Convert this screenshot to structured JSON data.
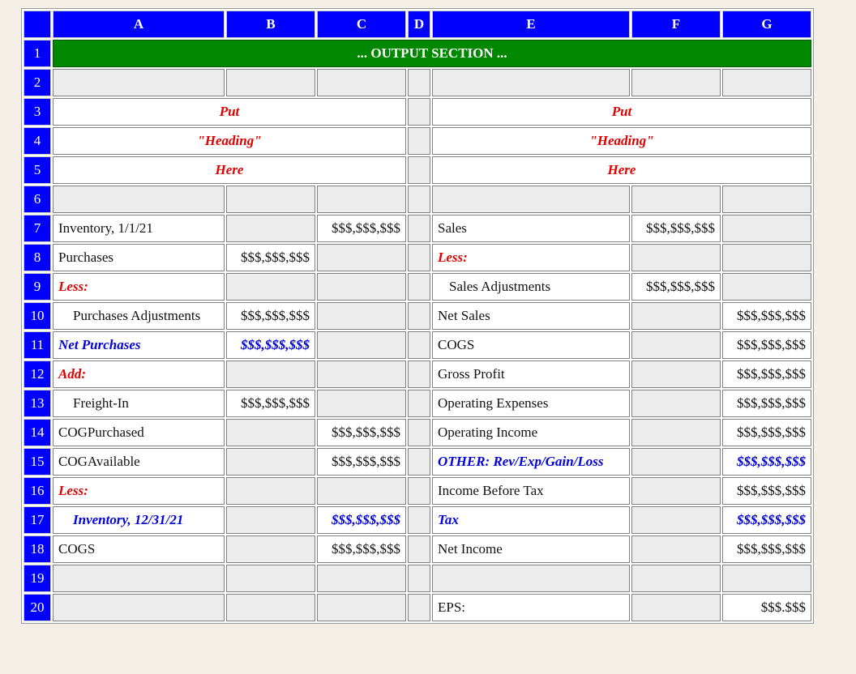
{
  "columns": [
    "A",
    "B",
    "C",
    "D",
    "E",
    "F",
    "G"
  ],
  "rows": [
    "1",
    "2",
    "3",
    "4",
    "5",
    "6",
    "7",
    "8",
    "9",
    "10",
    "11",
    "12",
    "13",
    "14",
    "15",
    "16",
    "17",
    "18",
    "19",
    "20"
  ],
  "title": "... OUTPUT SECTION ...",
  "heading": [
    "Put",
    "\"Heading\"",
    "Here"
  ],
  "left": {
    "inventory_begin": "Inventory, 1/1/21",
    "inventory_begin_amount": "$$$,$$$,$$$",
    "purchases": "Purchases",
    "purchases_amount": "$$$,$$$,$$$",
    "less": "Less:",
    "purchases_adjustments": "Purchases Adjustments",
    "purchases_adjustments_amount": "$$$,$$$,$$$",
    "net_purchases": "Net Purchases",
    "net_purchases_amount": "$$$,$$$,$$$",
    "add": "Add:",
    "freight_in": "Freight-In",
    "freight_in_amount": "$$$,$$$,$$$",
    "cog_purchased": "COGPurchased",
    "cog_purchased_amount": "$$$,$$$,$$$",
    "cog_available": "COGAvailable",
    "cog_available_amount": "$$$,$$$,$$$",
    "less2": "Less:",
    "inventory_end": "Inventory, 12/31/21",
    "inventory_end_amount": "$$$,$$$,$$$",
    "cogs": "COGS",
    "cogs_amount": "$$$,$$$,$$$"
  },
  "right": {
    "sales": "Sales",
    "sales_amount": "$$$,$$$,$$$",
    "less": "Less:",
    "sales_adjustments": "Sales Adjustments",
    "sales_adjustments_amount": "$$$,$$$,$$$",
    "net_sales": "Net Sales",
    "net_sales_amount": "$$$,$$$,$$$",
    "cogs": "COGS",
    "cogs_amount": "$$$,$$$,$$$",
    "gross_profit": "Gross Profit",
    "gross_profit_amount": "$$$,$$$,$$$",
    "operating_expenses": "Operating Expenses",
    "operating_expenses_amount": "$$$,$$$,$$$",
    "operating_income": "Operating Income",
    "operating_income_amount": "$$$,$$$,$$$",
    "other": "OTHER: Rev/Exp/Gain/Loss",
    "other_amount": "$$$,$$$,$$$",
    "income_before_tax": "Income Before Tax",
    "income_before_tax_amount": "$$$,$$$,$$$",
    "tax": "Tax",
    "tax_amount": "$$$,$$$,$$$",
    "net_income": "Net Income",
    "net_income_amount": "$$$,$$$,$$$",
    "eps": "EPS:",
    "eps_amount": "$$$.$$$"
  },
  "colors": {
    "header_blue": "#0000ff",
    "output_green": "#008800",
    "label_red": "#e00000",
    "label_blue": "#0000e0",
    "empty_cell_gray": "#ececec"
  }
}
